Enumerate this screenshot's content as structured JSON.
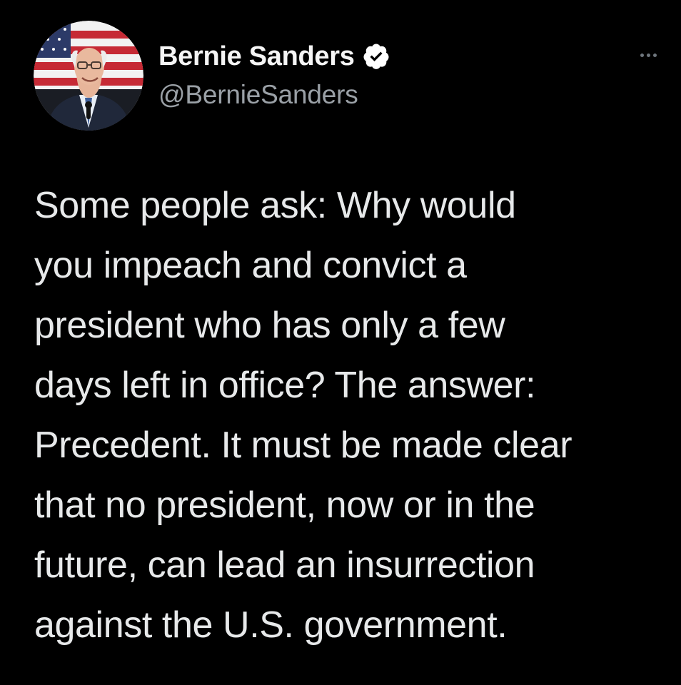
{
  "author": {
    "display_name": "Bernie Sanders",
    "handle": "@BernieSanders",
    "verified": true,
    "avatar_icon": "profile-photo"
  },
  "header": {
    "more_icon": "more-options-icon"
  },
  "tweet": {
    "lines": [
      "Some people ask: Why would",
      "you impeach and convict a",
      "president who has only a few",
      "days left in office? The answer:",
      "Precedent. It must be made clear",
      "that no president, now or in the",
      "future, can lead an insurrection",
      "against the U.S. government."
    ]
  },
  "colors": {
    "background": "#000000",
    "text": "#e7e9ea",
    "secondary_text": "#9aa0a6",
    "verified_badge": "#ffffff"
  }
}
